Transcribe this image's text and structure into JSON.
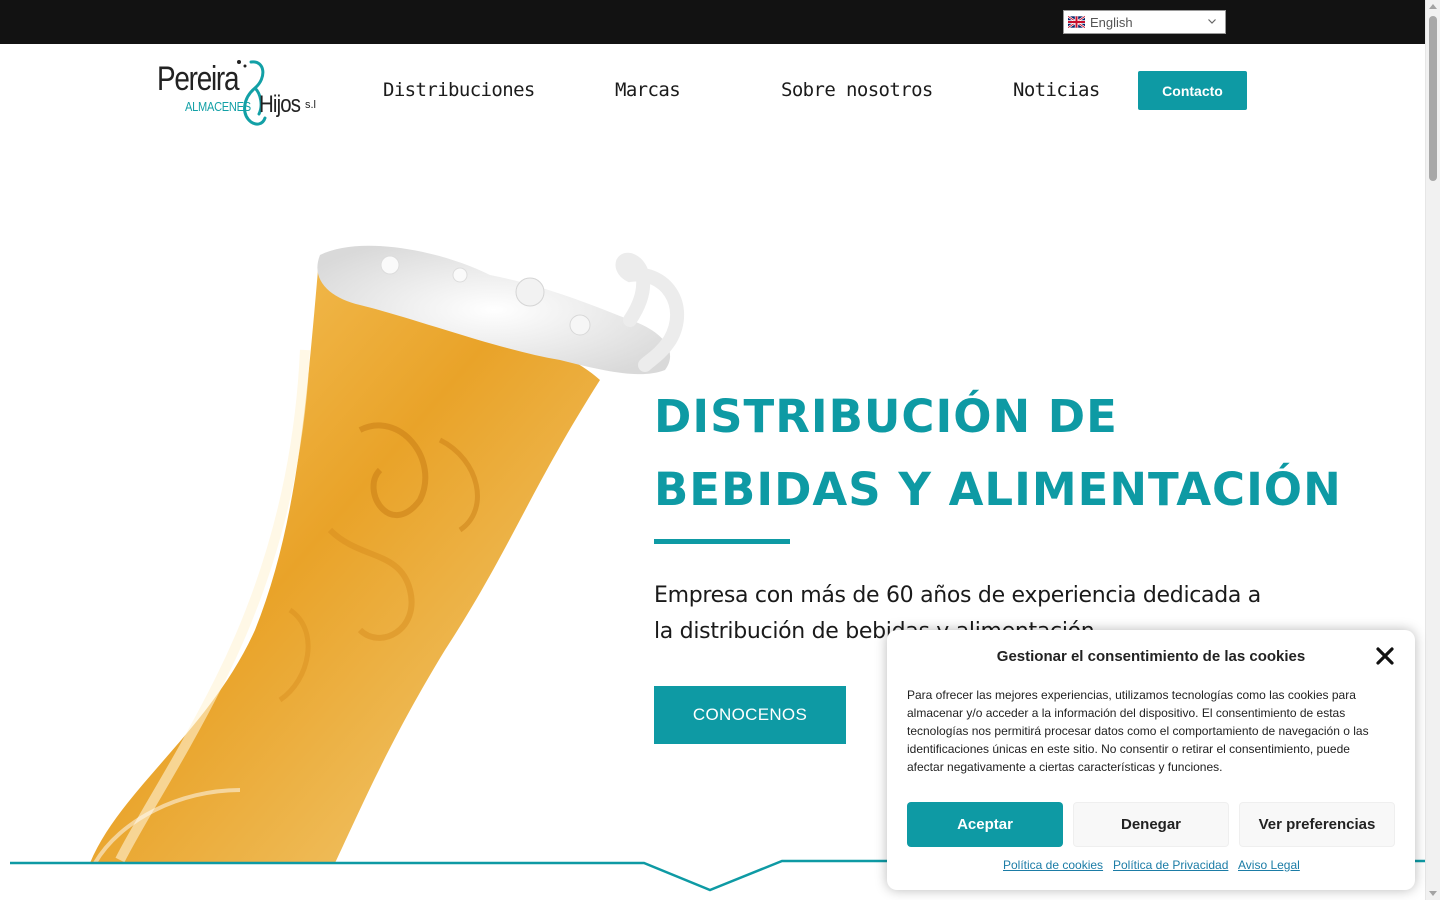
{
  "topbar": {
    "language": "English"
  },
  "header": {
    "logo": {
      "main": "Pereira",
      "sub": "ALMACENES",
      "hijos": "Hijos",
      "sl": "s.l"
    },
    "nav": [
      {
        "label": "Distribuciones"
      },
      {
        "label": "Marcas"
      },
      {
        "label": "Sobre nosotros"
      },
      {
        "label": "Noticias"
      }
    ],
    "contact_label": "Contacto"
  },
  "hero": {
    "title_line1": "DISTRIBUCIÓN DE",
    "title_line2": "BEBIDAS Y ALIMENTACIÓN",
    "text": "Empresa con más de 60 años de experiencia dedicada a la distribución de bebidas y alimentación.",
    "cta": "CONOCENOS"
  },
  "cookie": {
    "title": "Gestionar el consentimiento de las cookies",
    "body": "Para ofrecer las mejores experiencias, utilizamos tecnologías como las cookies para almacenar y/o acceder a la información del dispositivo. El consentimiento de estas tecnologías nos permitirá procesar datos como el comportamiento de navegación o las identificaciones únicas en este sitio. No consentir o retirar el consentimiento, puede afectar negativamente a ciertas características y funciones.",
    "accept": "Aceptar",
    "deny": "Denegar",
    "preferences": "Ver preferencias",
    "links": [
      {
        "label": "Política de cookies"
      },
      {
        "label": "Política de Privacidad"
      },
      {
        "label": "Aviso Legal"
      }
    ]
  },
  "colors": {
    "accent": "#0e9aa4",
    "topbar": "#121212",
    "link": "#1b7ca6"
  },
  "icons": [
    "uk-flag-icon",
    "chevron-down-icon",
    "close-icon",
    "beer-glass-image"
  ]
}
